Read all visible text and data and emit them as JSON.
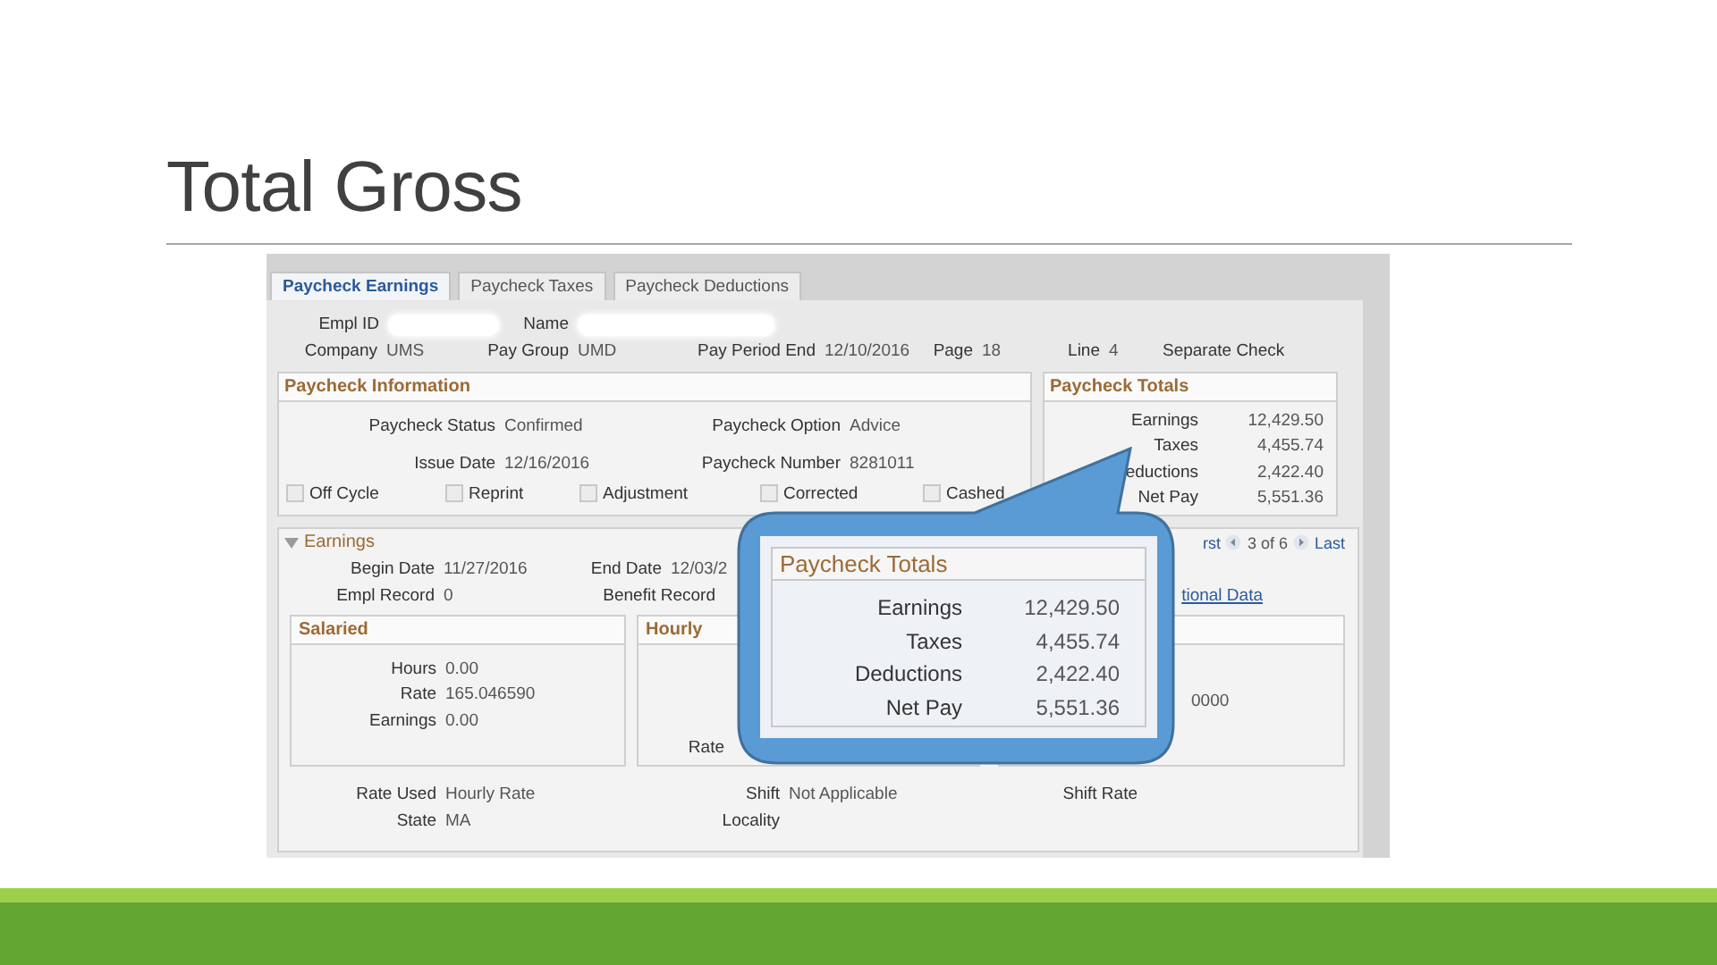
{
  "slide": {
    "title": "Total Gross"
  },
  "tabs": [
    {
      "label": "Paycheck Earnings",
      "selected": true
    },
    {
      "label": "Paycheck Taxes",
      "selected": false
    },
    {
      "label": "Paycheck Deductions",
      "selected": false
    }
  ],
  "header_rows": [
    [
      {
        "label": "Empl ID",
        "redacted": true
      },
      {
        "label": "Name",
        "redacted": true
      }
    ],
    [
      {
        "label": "Company",
        "value": "UMS"
      },
      {
        "label": "Pay Group",
        "value": "UMD"
      },
      {
        "label": "Pay Period End",
        "value": "12/10/2016"
      },
      {
        "label": "Page",
        "value": "18"
      },
      {
        "label": "Line",
        "value": "4"
      },
      {
        "label": "Separate Check"
      }
    ]
  ],
  "paycheck_information": {
    "title": "Paycheck Information",
    "rows": [
      [
        {
          "label": "Paycheck Status",
          "value": "Confirmed"
        },
        {
          "label": "Paycheck Option",
          "value": "Advice"
        }
      ],
      [
        {
          "label": "Issue Date",
          "value": "12/16/2016"
        },
        {
          "label": "Paycheck Number",
          "value": "8281011"
        }
      ]
    ],
    "checkboxes": [
      {
        "label": "Off Cycle",
        "checked": false
      },
      {
        "label": "Reprint",
        "checked": false
      },
      {
        "label": "Adjustment",
        "checked": false
      },
      {
        "label": "Corrected",
        "checked": false
      },
      {
        "label": "Cashed",
        "checked": false
      }
    ]
  },
  "paycheck_totals": {
    "title": "Paycheck Totals",
    "rows": [
      {
        "label": "Earnings",
        "value": "12,429.50"
      },
      {
        "label": "Taxes",
        "value": "4,455.74"
      },
      {
        "label": "eductions",
        "value": "2,422.40"
      },
      {
        "label": "Net Pay",
        "value": "5,551.36"
      }
    ]
  },
  "earnings": {
    "title": "Earnings",
    "expanded": true,
    "nav": {
      "first": "rst",
      "position": "3 of 6",
      "last": "Last"
    },
    "rows": [
      [
        {
          "label": "Begin Date",
          "value": "11/27/2016"
        },
        {
          "label": "End Date",
          "value": "12/03/2"
        }
      ],
      [
        {
          "label": "Empl Record",
          "value": "0"
        },
        {
          "label": "Benefit Record"
        }
      ]
    ],
    "link": "tional Data",
    "boxes": [
      {
        "title": "Salaried",
        "fields": [
          {
            "label": "Hours",
            "value": "0.00"
          },
          {
            "label": "Rate",
            "value": "165.046590"
          },
          {
            "label": "Earnings",
            "value": "0.00"
          }
        ]
      },
      {
        "title": "Hourly",
        "fields": [
          {
            "label": "Rate"
          }
        ]
      },
      {
        "fields": [
          {
            "value": "0000"
          }
        ]
      }
    ],
    "bottom_rows": [
      [
        {
          "label": "Rate Used",
          "value": "Hourly Rate"
        },
        {
          "label": "Shift",
          "value": "Not Applicable"
        },
        {
          "label": "Shift Rate"
        }
      ],
      [
        {
          "label": "State",
          "value": "MA"
        },
        {
          "label": "Locality"
        }
      ]
    ]
  },
  "callout": {
    "title": "Paycheck Totals",
    "rows": [
      {
        "label": "Earnings",
        "value": "12,429.50"
      },
      {
        "label": "Taxes",
        "value": "4,455.74"
      },
      {
        "label": "Deductions",
        "value": "2,422.40"
      },
      {
        "label": "Net Pay",
        "value": "5,551.36"
      }
    ]
  }
}
